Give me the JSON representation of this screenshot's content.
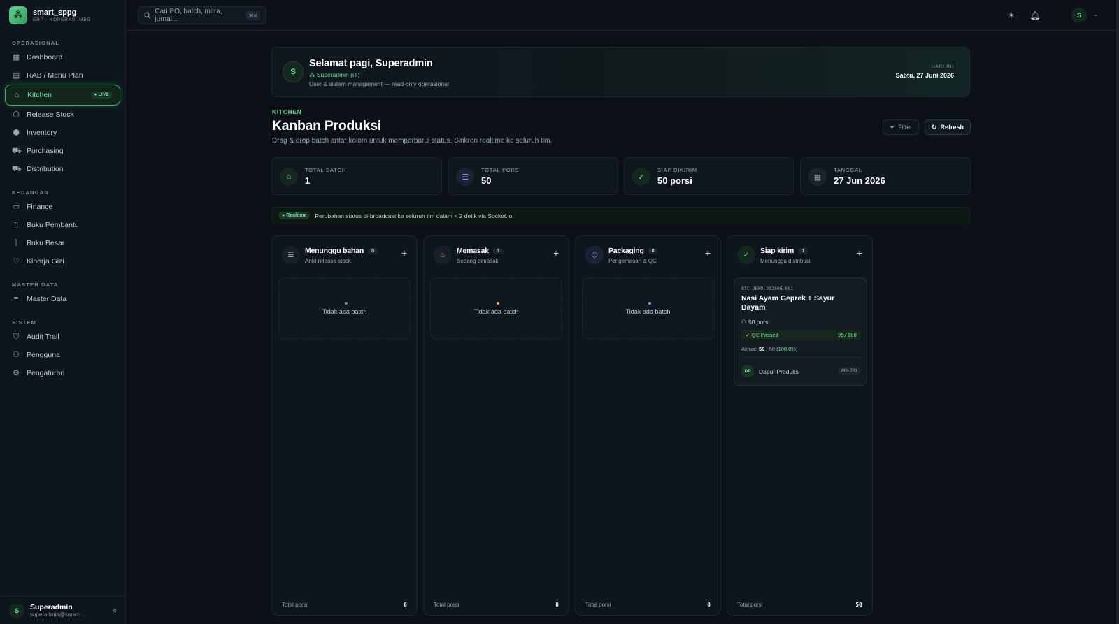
{
  "brand": {
    "name": "smart_sppg",
    "sub": "ERP · KOPERASI MBG"
  },
  "sidebar": {
    "sections": [
      {
        "label": "OPERASIONAL"
      },
      {
        "label": "KEUANGAN"
      },
      {
        "label": "MASTER DATA"
      },
      {
        "label": "SISTEM"
      }
    ],
    "items": [
      {
        "label": "Dashboard"
      },
      {
        "label": "RAB / Menu Plan"
      },
      {
        "label": "Kitchen",
        "badge": "LIVE"
      },
      {
        "label": "Release Stock"
      },
      {
        "label": "Inventory"
      },
      {
        "label": "Purchasing"
      },
      {
        "label": "Distribution"
      },
      {
        "label": "Finance"
      },
      {
        "label": "Buku Pembantu"
      },
      {
        "label": "Buku Besar"
      },
      {
        "label": "Kinerja Gizi"
      },
      {
        "label": "Master Data"
      },
      {
        "label": "Audit Trail"
      },
      {
        "label": "Pengguna"
      },
      {
        "label": "Pengaturan"
      }
    ],
    "user": {
      "initial": "S",
      "name": "Superadmin",
      "email": "superadmin@smart-..."
    }
  },
  "topbar": {
    "search_placeholder": "Cari PO, batch, mitra, jurnal...",
    "shortcut": "⌘K",
    "avatar": "S"
  },
  "greeting": {
    "initial": "S",
    "title": "Selamat pagi, Superadmin",
    "role": "Superadmin (IT)",
    "desc": "User & sistem management — read-only operasional",
    "today_label": "HARI INI",
    "today": "Sabtu, 27 Juni 2026"
  },
  "page": {
    "kicker": "KITCHEN",
    "title": "Kanban Produksi",
    "desc": "Drag & drop batch antar kolom untuk memperbarui status. Sinkron realtime ke seluruh tim.",
    "filter_label": "Filter",
    "refresh_label": "Refresh"
  },
  "stats": [
    {
      "label": "TOTAL BATCH",
      "value": "1"
    },
    {
      "label": "TOTAL PORSI",
      "value": "50"
    },
    {
      "label": "SIAP DIKIRIM",
      "value": "50 porsi"
    },
    {
      "label": "TANGGAL",
      "value": "27 Jun 2026"
    }
  ],
  "realtime": {
    "badge": "Realtime",
    "text": "Perubahan status di-broadcast ke seluruh tim dalam < 2 detik via Socket.io."
  },
  "columns": [
    {
      "title": "Menunggu bahan",
      "count": "0",
      "sub": "Antri release stock",
      "empty": "Tidak ada batch",
      "foot_label": "Total porsi",
      "foot_value": "0"
    },
    {
      "title": "Memasak",
      "count": "0",
      "sub": "Sedang dimasak",
      "empty": "Tidak ada batch",
      "foot_label": "Total porsi",
      "foot_value": "0"
    },
    {
      "title": "Packaging",
      "count": "0",
      "sub": "Pengemasan & QC",
      "empty": "Tidak ada batch",
      "foot_label": "Total porsi",
      "foot_value": "0"
    },
    {
      "title": "Siap kirim",
      "count": "1",
      "sub": "Menunggu distribusi",
      "foot_label": "Total porsi",
      "foot_value": "50"
    }
  ],
  "batch_card": {
    "code": "BTC-DEMO-202606-001",
    "title": "Nasi Ayam Geprek + Sayur Bayam",
    "porsi": "50 porsi",
    "qc_label": "QC Passed",
    "qc_score": "95/100",
    "aktual_prefix": "Aktual:",
    "aktual_value": "50",
    "aktual_total": "/ 50",
    "aktual_pct": "(100.0%)",
    "kitchen_initial": "DP",
    "kitchen_name": "Dapur Produksi",
    "kitchen_code": "MN-001"
  },
  "colors": {
    "accent": "#5fd38a",
    "bg": "#0c1117",
    "panel": "#0f151c"
  }
}
